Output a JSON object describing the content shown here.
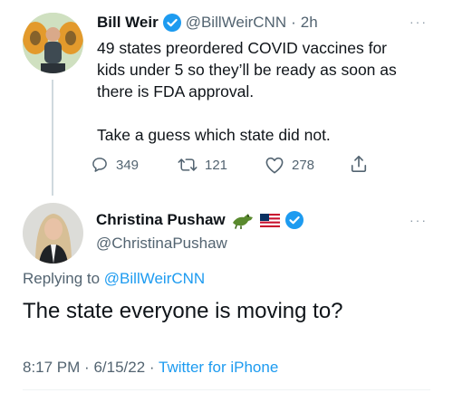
{
  "tweet1": {
    "name": "Bill Weir",
    "handle": "@BillWeirCNN",
    "time": "2h",
    "separator": "·",
    "line1": "49 states preordered COVID vaccines for",
    "line2": "kids under 5 so they’ll be ready as soon as",
    "line3": "there is FDA approval.",
    "line4": "Take a guess which state did not.",
    "replies": "349",
    "retweets": "121",
    "likes": "278",
    "more": "···"
  },
  "tweet2": {
    "name": "Christina Pushaw",
    "handle": "@ChristinaPushaw",
    "replying_prefix": "Replying to",
    "replying_to": "@BillWeirCNN",
    "text": "The state everyone is moving to?",
    "time": "8:17 PM",
    "separator": "·",
    "date": "6/15/22",
    "source": "Twitter for iPhone",
    "more": "···"
  },
  "colors": {
    "text": "#0f1419",
    "muted": "#536471",
    "accent": "#1d9bf0"
  }
}
